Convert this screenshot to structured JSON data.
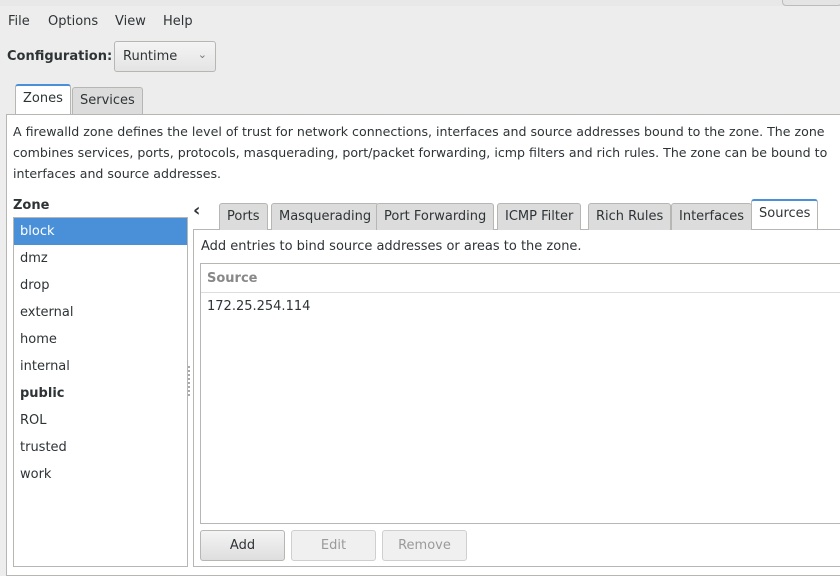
{
  "menu": [
    "File",
    "Options",
    "View",
    "Help"
  ],
  "configuration": {
    "label": "Configuration:",
    "value": "Runtime"
  },
  "main_tabs": [
    {
      "label": "Zones",
      "active": true
    },
    {
      "label": "Services",
      "active": false
    }
  ],
  "description": "A firewalld zone defines the level of trust for network connections, interfaces and source addresses bound to the zone. The zone combines services, ports, protocols, masquerading, port/packet forwarding, icmp filters and rich rules. The zone can be bound to interfaces and source addresses.",
  "zone": {
    "heading": "Zone",
    "items": [
      {
        "label": "block",
        "selected": true
      },
      {
        "label": "dmz"
      },
      {
        "label": "drop"
      },
      {
        "label": "external"
      },
      {
        "label": "home"
      },
      {
        "label": "internal"
      },
      {
        "label": "public",
        "bold": true
      },
      {
        "label": "ROL"
      },
      {
        "label": "trusted"
      },
      {
        "label": "work"
      }
    ]
  },
  "sub_tabs": [
    "Ports",
    "Masquerading",
    "Port Forwarding",
    "ICMP Filter",
    "Rich Rules",
    "Interfaces",
    "Sources"
  ],
  "active_sub_tab": "Sources",
  "sources": {
    "hint": "Add entries to bind source addresses or areas to the zone.",
    "column": "Source",
    "rows": [
      "172.25.254.114"
    ]
  },
  "buttons": {
    "add": "Add",
    "edit": "Edit",
    "remove": "Remove"
  },
  "colors": {
    "accent": "#4a90d9"
  }
}
